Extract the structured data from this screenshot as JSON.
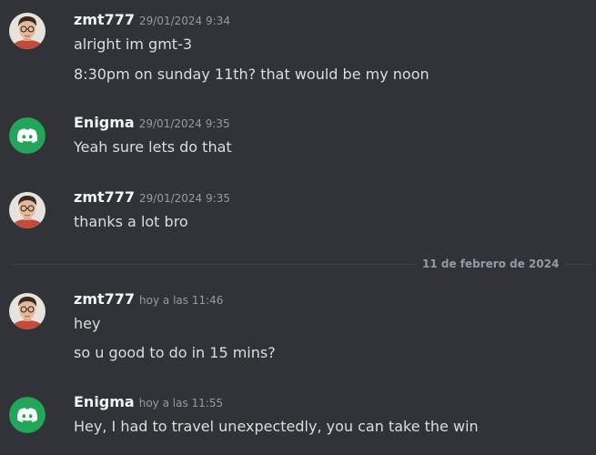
{
  "colors": {
    "background": "#313338",
    "discord_green": "#23a55a",
    "username": "#f2f3f5",
    "text": "#dbdee1",
    "muted": "#949ba4"
  },
  "messages": [
    {
      "author": "zmt777",
      "avatar_icon": "person-photo-avatar",
      "timestamp": "29/01/2024 9:34",
      "lines": [
        "alright im gmt-3",
        "8:30pm on sunday 11th? that would be my noon"
      ]
    },
    {
      "author": "Enigma",
      "avatar_icon": "discord-logo-avatar",
      "timestamp": "29/01/2024 9:35",
      "lines": [
        "Yeah sure lets do that"
      ]
    },
    {
      "author": "zmt777",
      "avatar_icon": "person-photo-avatar",
      "timestamp": "29/01/2024 9:35",
      "lines": [
        "thanks a lot bro"
      ]
    },
    {
      "author": "zmt777",
      "avatar_icon": "person-photo-avatar",
      "timestamp": "hoy a las 11:46",
      "lines": [
        "hey",
        "so u good to do in 15 mins?"
      ]
    },
    {
      "author": "Enigma",
      "avatar_icon": "discord-logo-avatar",
      "timestamp": "hoy a las 11:55",
      "lines": [
        "Hey, I had to travel unexpectedly, you can take the win"
      ]
    }
  ],
  "date_divider": {
    "label": "11 de febrero de 2024"
  }
}
